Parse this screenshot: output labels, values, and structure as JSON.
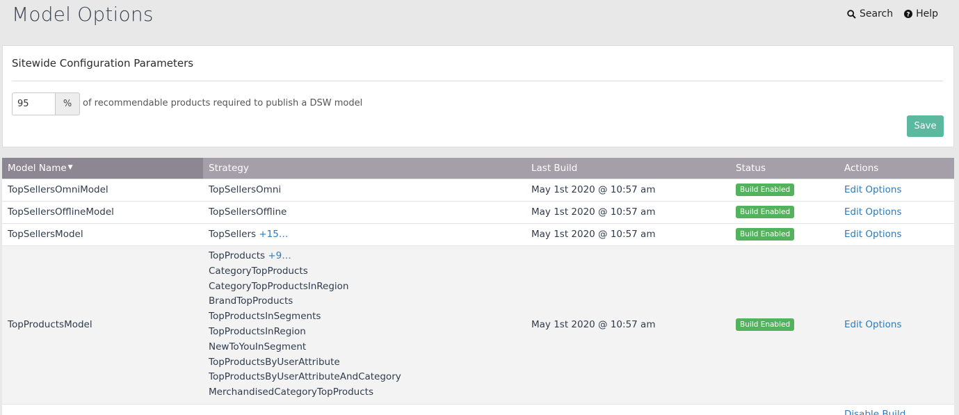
{
  "header": {
    "title": "Model Options",
    "search_label": "Search",
    "help_label": "Help"
  },
  "config": {
    "title": "Sitewide Configuration Parameters",
    "percent_value": "95",
    "percent_symbol": "%",
    "description": "of recommendable products required to publish a DSW model",
    "save_label": "Save"
  },
  "table": {
    "columns": [
      "Model Name",
      "Strategy",
      "Last Build",
      "Status",
      "Actions"
    ],
    "rows": [
      {
        "name": "TopSellersOmniModel",
        "strategy": "TopSellersOmni",
        "more": "",
        "last_build": "May 1st 2020 @ 10:57 am",
        "status": "Build Enabled",
        "action": "Edit Options"
      },
      {
        "name": "TopSellersOfflineModel",
        "strategy": "TopSellersOffline",
        "more": "",
        "last_build": "May 1st 2020 @ 10:57 am",
        "status": "Build Enabled",
        "action": "Edit Options"
      },
      {
        "name": "TopSellersModel",
        "strategy": "TopSellers",
        "more": "+15…",
        "last_build": "May 1st 2020 @ 10:57 am",
        "status": "Build Enabled",
        "action": "Edit Options"
      },
      {
        "name": "TopProductsModel",
        "strategy": "TopProducts",
        "more": "+9…",
        "last_build": "May 1st 2020 @ 10:57 am",
        "status": "Build Enabled",
        "action": "Edit Options",
        "strategies": [
          "CategoryTopProducts",
          "CategoryTopProductsInRegion",
          "BrandTopProducts",
          "TopProductsInSegments",
          "TopProductsInRegion",
          "NewToYouInSegment",
          "TopProductsByUserAttribute",
          "TopProductsByUserAttributeAndCategory",
          "MerchandisedCategoryTopProducts"
        ]
      }
    ],
    "partial_action": "Disable Build"
  },
  "colors": {
    "accent_green": "#5cb89e",
    "badge_green": "#53b35c",
    "header_gray": "#a49fa9",
    "link_blue": "#2b7bbf"
  }
}
